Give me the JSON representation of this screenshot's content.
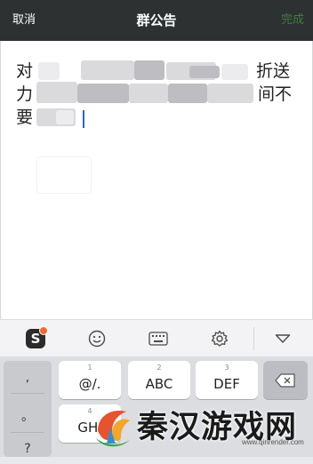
{
  "header": {
    "cancel_label": "取消",
    "title": "群公告",
    "done_label": "完成"
  },
  "editor": {
    "line1": {
      "start": "对",
      "end": "折送"
    },
    "line2": {
      "start": "力",
      "end": "间不"
    },
    "line3": {
      "start": "要"
    }
  },
  "toolbar": {
    "icons": [
      "sogou-logo-icon",
      "emoji-icon",
      "keyboard-icon",
      "settings-icon",
      "collapse-icon"
    ],
    "sogou_glyph": "S"
  },
  "keyboard": {
    "left_column": [
      ",",
      "。",
      "?"
    ],
    "keys": [
      {
        "num": "1",
        "label": "@/."
      },
      {
        "num": "2",
        "label": "ABC"
      },
      {
        "num": "3",
        "label": "DEF"
      },
      {
        "num": "4",
        "label": "GHI"
      }
    ],
    "delete_icon": "backspace-icon"
  },
  "watermark": {
    "text": "秦汉游戏网",
    "url": "www.qinrender.com"
  },
  "colors": {
    "header_bg": "#2e3132",
    "done_green": "#3d7d3d",
    "caret_blue": "#2a64d6",
    "sogou_orange": "#f06a2a"
  }
}
